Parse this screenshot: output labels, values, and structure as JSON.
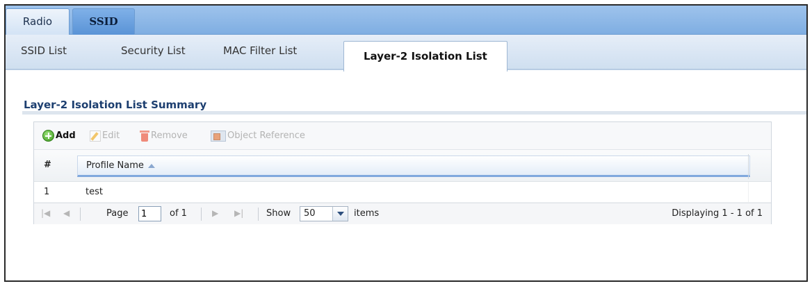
{
  "top_tabs": [
    {
      "label": "Radio",
      "active": false
    },
    {
      "label": "SSID",
      "active": true
    }
  ],
  "sub_tabs": [
    {
      "label": "SSID List",
      "active": false
    },
    {
      "label": "Security List",
      "active": false
    },
    {
      "label": "MAC Filter List",
      "active": false
    },
    {
      "label": "Layer-2 Isolation List",
      "active": true
    }
  ],
  "section": {
    "title": "Layer-2 Isolation List Summary"
  },
  "toolbar": {
    "add": {
      "label": "Add",
      "icon": "add-icon",
      "enabled": true
    },
    "edit": {
      "label": "Edit",
      "icon": "edit-icon",
      "enabled": false
    },
    "remove": {
      "label": "Remove",
      "icon": "trash-icon",
      "enabled": false
    },
    "reference": {
      "label": "Object Reference",
      "icon": "object-reference-icon",
      "enabled": false
    }
  },
  "table": {
    "columns": [
      "#",
      "Profile Name"
    ],
    "sort_icon": "sort-ascending-icon",
    "rows": [
      {
        "index": "1",
        "name": "test"
      }
    ]
  },
  "pager": {
    "page_label": "Page",
    "page_value": "1",
    "of_label": "of 1",
    "show_label": "Show",
    "show_value": "50",
    "items_label": "items",
    "displaying": "Displaying 1 - 1 of 1"
  },
  "colors": {
    "tab_bar": "#7faee2",
    "title": "#1d3f70",
    "add_green": "#3e9a1e"
  }
}
